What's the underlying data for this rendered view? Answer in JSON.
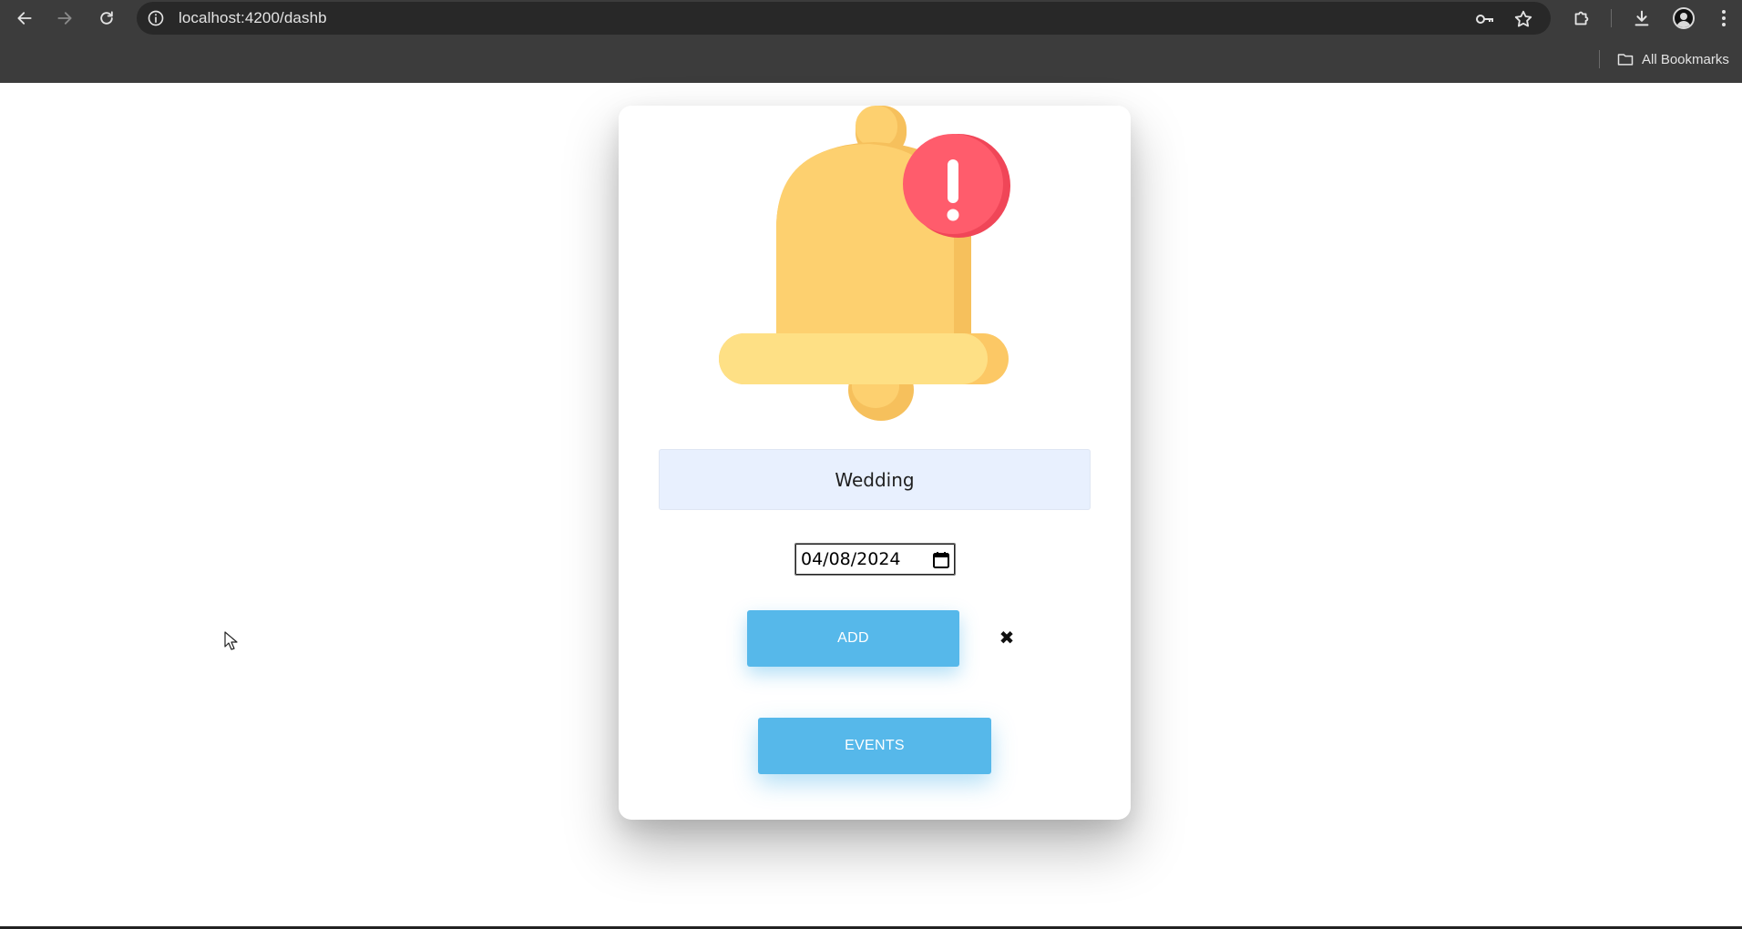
{
  "browser": {
    "url": "localhost:4200/dashb",
    "bookmarks_label": "All Bookmarks",
    "icons": {
      "back": "back-arrow-icon",
      "forward": "forward-arrow-icon",
      "reload": "reload-icon",
      "site_info": "info-icon",
      "password": "key-icon",
      "bookmark": "star-icon",
      "extensions": "puzzle-icon",
      "downloads": "download-icon",
      "profile": "avatar-icon",
      "menu": "kebab-menu-icon",
      "bookmarks_folder": "folder-icon"
    }
  },
  "page": {
    "illustration": "bell-alert-icon",
    "event_name_value": "Wedding",
    "event_date_value": "04/08/2024",
    "add_label": "ADD",
    "close_symbol": "✖",
    "events_label": "EVENTS",
    "colors": {
      "button": "#56b8ea",
      "bell": "#fdd06f",
      "alert": "#ff5c6c",
      "input_bg": "#e8f0fe"
    }
  }
}
